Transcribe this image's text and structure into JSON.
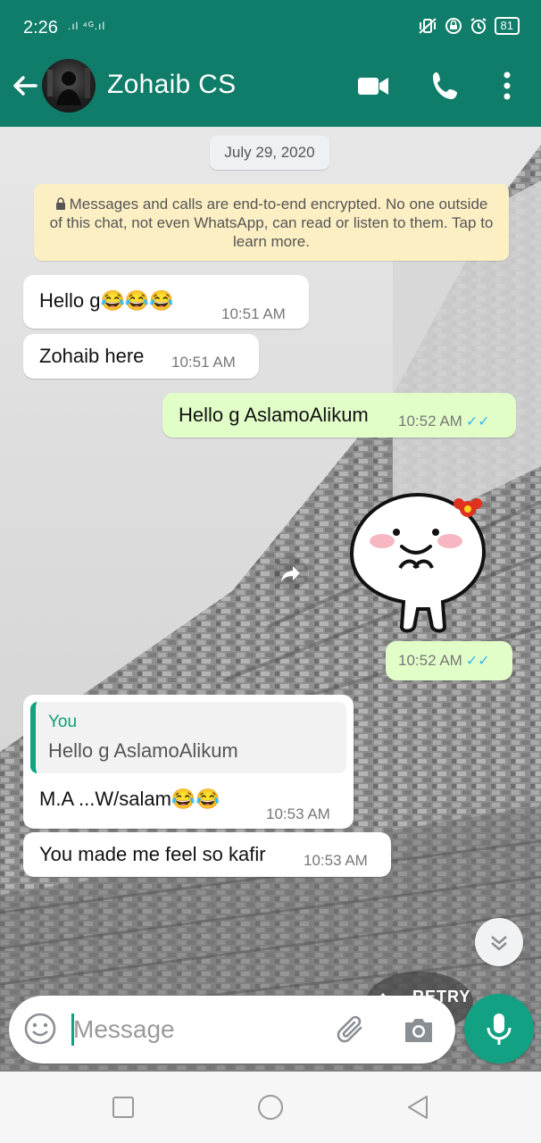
{
  "status_bar": {
    "time": "2:26",
    "signal_text": ".ıl ⁴ᴳ.ıl",
    "battery": "81"
  },
  "header": {
    "contact_name": "Zohaib CS"
  },
  "chat": {
    "date_chip": "July 29, 2020",
    "encryption_notice": "Messages and calls are end-to-end encrypted. No one outside of this chat, not even WhatsApp, can read or listen to them. Tap to learn more.",
    "messages": [
      {
        "text": "Hello g😂😂😂",
        "time": "10:51 AM",
        "direction": "in"
      },
      {
        "text": "Zohaib here",
        "time": "10:51 AM",
        "direction": "in"
      },
      {
        "text": "Hello g AslamoAlikum",
        "time": "10:52 AM",
        "direction": "out",
        "status": "✓✓"
      },
      {
        "text": "",
        "time": "10:52 AM",
        "direction": "out",
        "status": "✓✓",
        "kind": "sticker"
      },
      {
        "quote_author": "You",
        "quote_text": "Hello g AslamoAlikum",
        "text": "M.A ...W/salam😂😂",
        "time": "10:53 AM",
        "direction": "in"
      },
      {
        "text": "You made me feel so kafir",
        "time": "10:53 AM",
        "direction": "in"
      }
    ],
    "retry_label": "RETRY"
  },
  "composer": {
    "placeholder": "Message"
  },
  "colors": {
    "header": "#0f7d69",
    "outgoing_bubble": "#e2fec8",
    "accent": "#13a183",
    "read_ticks": "#34b7f1"
  },
  "icons": [
    "back-arrow-icon",
    "video-call-icon",
    "phone-icon",
    "more-vert-icon",
    "lock-icon",
    "emoji-icon",
    "attach-icon",
    "camera-icon",
    "mic-icon",
    "scroll-down-icon",
    "upload-icon",
    "nav-square-icon",
    "nav-home-icon",
    "nav-back-icon"
  ]
}
